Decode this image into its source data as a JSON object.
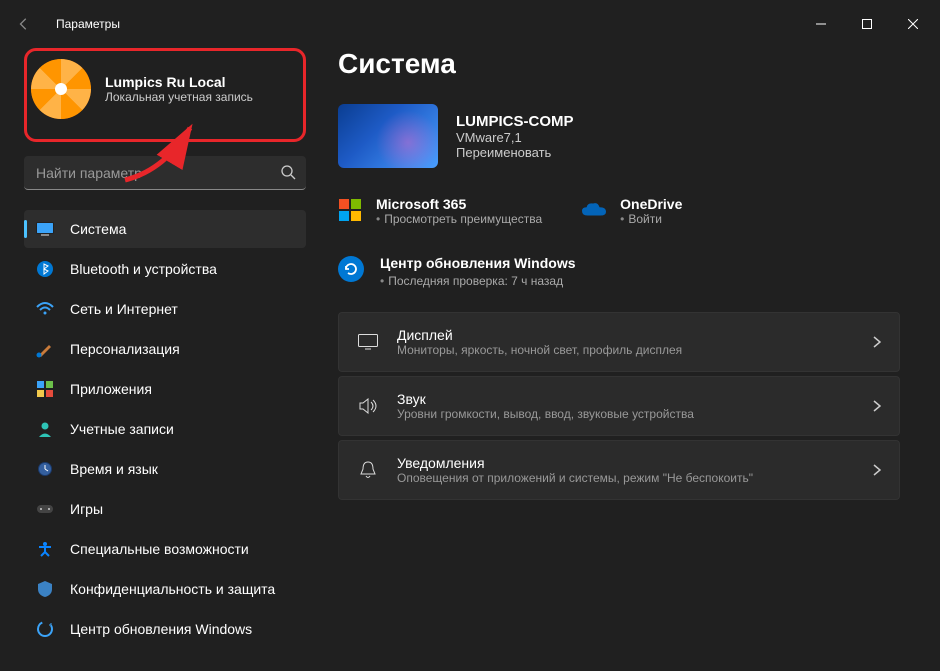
{
  "window": {
    "title": "Параметры"
  },
  "profile": {
    "name": "Lumpics Ru Local",
    "sub": "Локальная учетная запись"
  },
  "search": {
    "placeholder": "Найти параметр"
  },
  "nav": {
    "items": [
      {
        "label": "Система"
      },
      {
        "label": "Bluetooth и устройства"
      },
      {
        "label": "Сеть и Интернет"
      },
      {
        "label": "Персонализация"
      },
      {
        "label": "Приложения"
      },
      {
        "label": "Учетные записи"
      },
      {
        "label": "Время и язык"
      },
      {
        "label": "Игры"
      },
      {
        "label": "Специальные возможности"
      },
      {
        "label": "Конфиденциальность и защита"
      },
      {
        "label": "Центр обновления Windows"
      }
    ]
  },
  "main": {
    "title": "Система",
    "device": {
      "name": "LUMPICS-COMP",
      "model": "VMware7,1",
      "rename": "Переименовать"
    },
    "quick": {
      "m365": {
        "title": "Microsoft 365",
        "sub": "Просмотреть преимущества"
      },
      "onedrive": {
        "title": "OneDrive",
        "sub": "Войти"
      }
    },
    "update": {
      "title": "Центр обновления Windows",
      "sub": "Последняя проверка: 7 ч назад"
    },
    "cards": [
      {
        "title": "Дисплей",
        "sub": "Мониторы, яркость, ночной свет, профиль дисплея"
      },
      {
        "title": "Звук",
        "sub": "Уровни громкости, вывод, ввод, звуковые устройства"
      },
      {
        "title": "Уведомления",
        "sub": "Оповещения от приложений и системы, режим \"Не беспокоить\""
      }
    ]
  }
}
